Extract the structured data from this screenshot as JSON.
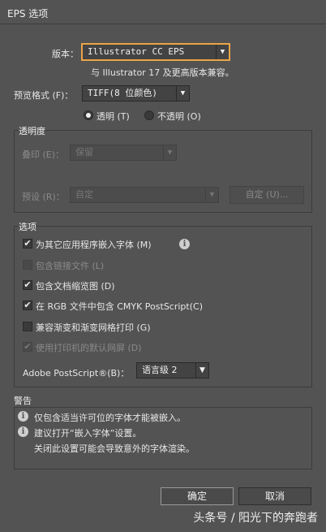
{
  "window": {
    "title": "EPS 选项"
  },
  "version": {
    "label": "版本：",
    "value": "Illustrator CC EPS",
    "note": "与 Illustrator 17 及更高版本兼容。"
  },
  "preview": {
    "label": "预览格式 (F)：",
    "value": "TIFF(8 位颜色)",
    "radio_transparent": "透明 (T)",
    "radio_opaque": "不透明 (O)",
    "selected": "透明 (T)"
  },
  "transparency": {
    "title": "透明度",
    "overprint_label": "叠印 (E)：",
    "overprint_value": "保留",
    "preset_label": "预设 (R)：",
    "preset_value": "自定",
    "custom_button": "自定 (U)..."
  },
  "options": {
    "title": "选项",
    "items": [
      {
        "label": "为其它应用程序嵌入字体 (M)",
        "checked": true,
        "enabled": true
      },
      {
        "label": "包含链接文件 (L)",
        "checked": false,
        "enabled": false
      },
      {
        "label": "包含文档缩览图 (D)",
        "checked": true,
        "enabled": true
      },
      {
        "label": "在 RGB 文件中包含 CMYK PostScript(C)",
        "checked": true,
        "enabled": true
      },
      {
        "label": "兼容渐变和渐变网格打印 (G)",
        "checked": false,
        "enabled": true
      },
      {
        "label": "使用打印机的默认网屏 (D)",
        "checked": true,
        "enabled": false
      }
    ],
    "postscript_label": "Adobe PostScript®(B)：",
    "postscript_value": "语言级 2"
  },
  "warnings": {
    "title": "警告",
    "line1": "仅包含适当许可位的字体才能被嵌入。",
    "line2": "建议打开“嵌入字体”设置。",
    "line3": "关闭此设置可能会导致意外的字体渲染。"
  },
  "buttons": {
    "ok": "确定",
    "cancel": "取消"
  },
  "watermark": "头条号 / 阳光下的奔跑者",
  "icons": {
    "check": "✔",
    "dropdown_arrow": "▼",
    "info": "i"
  }
}
